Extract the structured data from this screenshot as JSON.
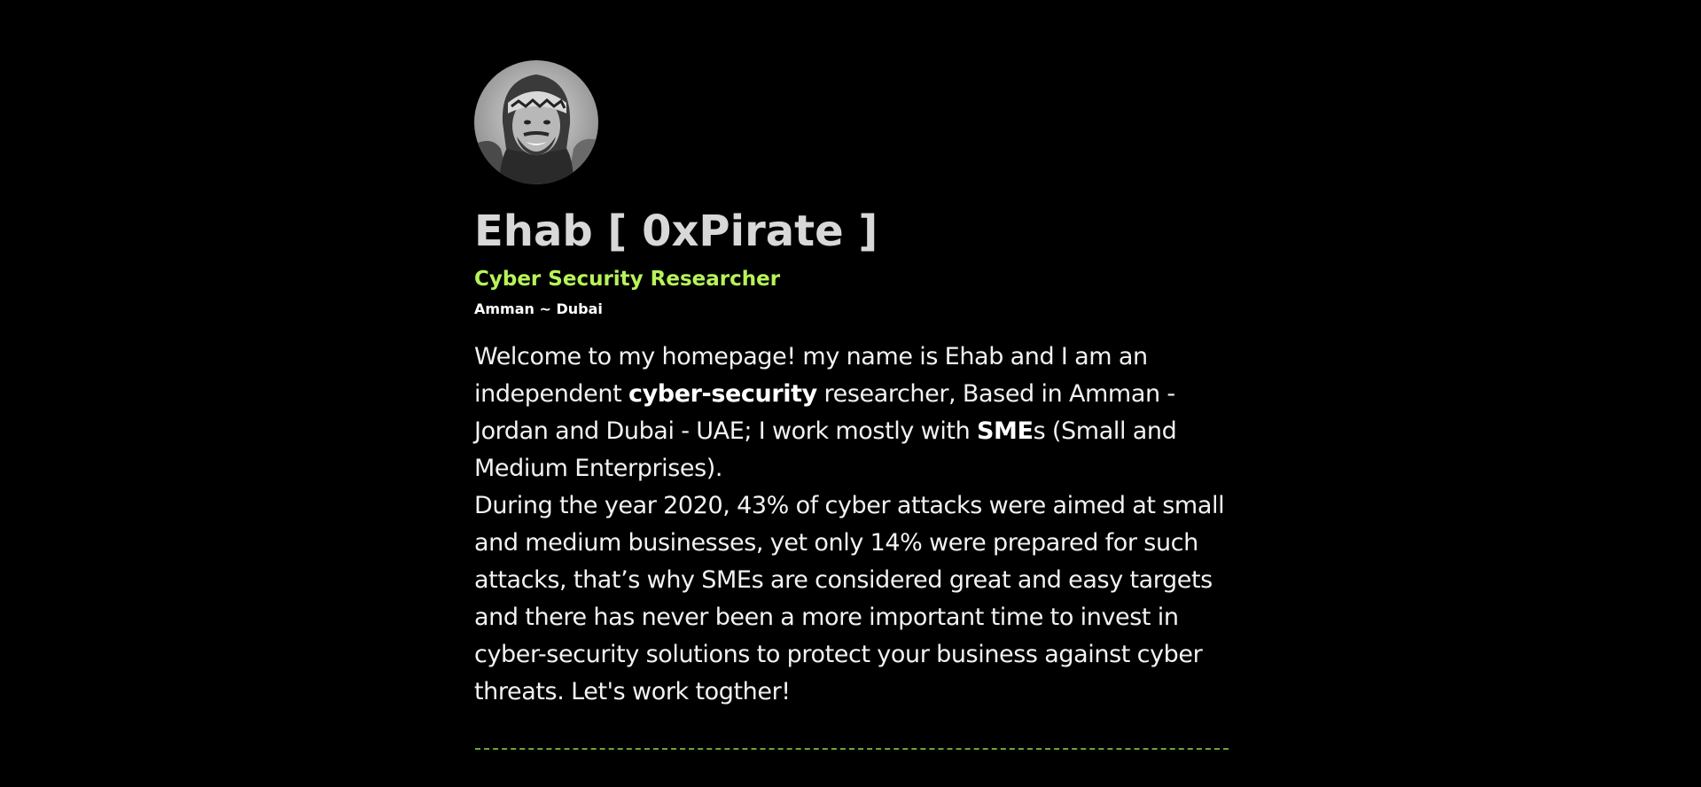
{
  "profile": {
    "avatar_alt": "Profile photo",
    "name": "Ehab [ 0xPirate ]",
    "role": "Cyber Security Researcher",
    "location": "Amman ~ Dubai"
  },
  "bio": {
    "p1_part1": "Welcome to my homepage! my name is Ehab and I am an independent ",
    "p1_strong1": "cyber-security",
    "p1_part2": " researcher, Based in Amman - Jordan and Dubai - UAE; I work mostly with ",
    "p1_strong2": "SME",
    "p1_part3": "s (Small and Medium Enterprises).",
    "p2": "During the year 2020, 43% of cyber attacks were aimed at small and medium businesses, yet only 14% were prepared for such attacks, that’s why SMEs are considered great and easy targets and there has never been a more important time to invest in cyber-security solutions to protect your business against cyber threats. Let's work togther!"
  },
  "colors": {
    "background": "#000000",
    "accent": "#b7f35a",
    "heading": "#d8d8d8",
    "text": "#f2f2f2",
    "divider": "#6aa53a"
  }
}
